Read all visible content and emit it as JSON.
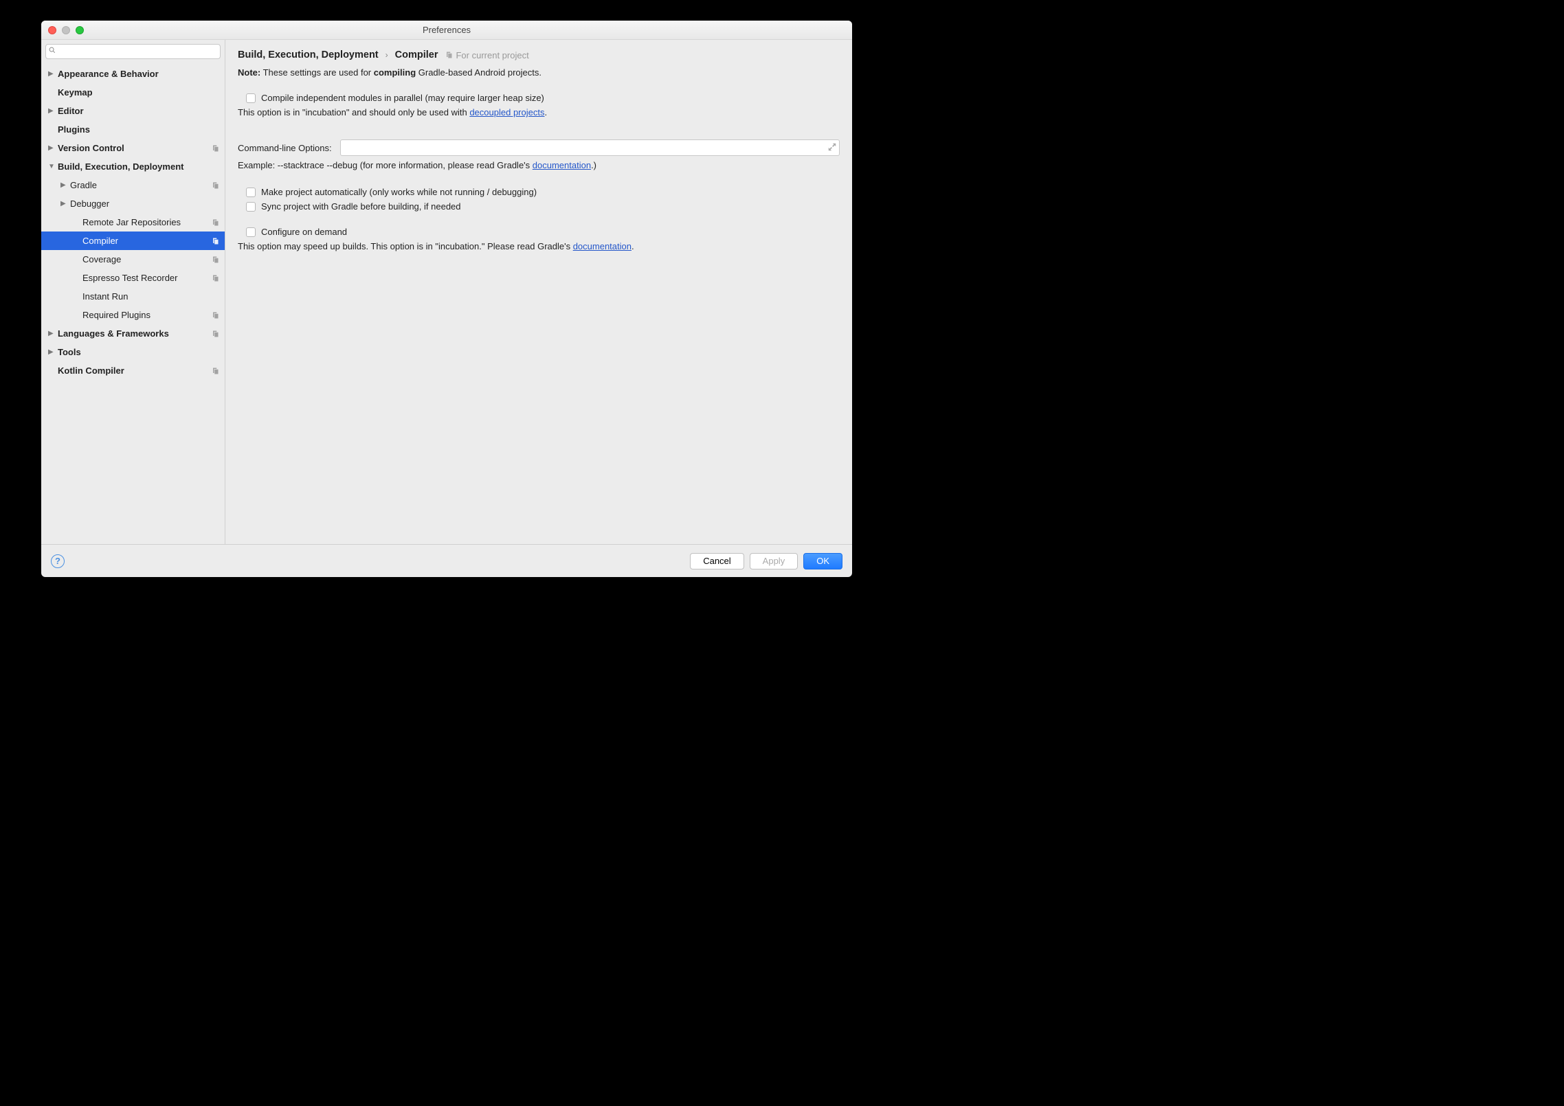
{
  "window": {
    "title": "Preferences"
  },
  "sidebar": {
    "search_placeholder": "",
    "items": [
      {
        "label": "Appearance & Behavior",
        "bold": true,
        "arrow": "right",
        "indent": 0
      },
      {
        "label": "Keymap",
        "bold": true,
        "indent": 0
      },
      {
        "label": "Editor",
        "bold": true,
        "arrow": "right",
        "indent": 0
      },
      {
        "label": "Plugins",
        "bold": true,
        "indent": 0
      },
      {
        "label": "Version Control",
        "bold": true,
        "arrow": "right",
        "indent": 0,
        "proj": true
      },
      {
        "label": "Build, Execution, Deployment",
        "bold": true,
        "arrow": "down",
        "indent": 0
      },
      {
        "label": "Gradle",
        "arrow": "right",
        "indent": 1,
        "proj": true
      },
      {
        "label": "Debugger",
        "arrow": "right",
        "indent": 1
      },
      {
        "label": "Remote Jar Repositories",
        "indent": 2,
        "proj": true
      },
      {
        "label": "Compiler",
        "indent": 2,
        "proj": true,
        "selected": true
      },
      {
        "label": "Coverage",
        "indent": 2,
        "proj": true
      },
      {
        "label": "Espresso Test Recorder",
        "indent": 2,
        "proj": true
      },
      {
        "label": "Instant Run",
        "indent": 2
      },
      {
        "label": "Required Plugins",
        "indent": 2,
        "proj": true
      },
      {
        "label": "Languages & Frameworks",
        "bold": true,
        "arrow": "right",
        "indent": 0,
        "proj": true
      },
      {
        "label": "Tools",
        "bold": true,
        "arrow": "right",
        "indent": 0
      },
      {
        "label": "Kotlin Compiler",
        "bold": true,
        "indent": 0,
        "proj": true
      }
    ]
  },
  "breadcrumb": {
    "parent": "Build, Execution, Deployment",
    "current": "Compiler",
    "scope": "For current project"
  },
  "content": {
    "note_prefix": "Note:",
    "note_mid1": " These settings are used for ",
    "note_bold": "compiling",
    "note_mid2": " Gradle-based Android projects.",
    "check1": "Compile independent modules in parallel (may require larger heap size)",
    "desc1_pre": "This option is in \"incubation\" and should only be used with ",
    "desc1_link": "decoupled projects",
    "desc1_post": ".",
    "cmd_label": "Command-line Options:",
    "cmd_value": "",
    "example_pre": "Example: --stacktrace --debug (for more information, please read Gradle's ",
    "example_link": "documentation",
    "example_post": ".)",
    "check2": "Make project automatically (only works while not running / debugging)",
    "check3": "Sync project with Gradle before building, if needed",
    "check4": "Configure on demand",
    "desc4_pre": "This option may speed up builds. This option is in \"incubation.\" Please read Gradle's ",
    "desc4_link": "documentation",
    "desc4_post": "."
  },
  "footer": {
    "cancel": "Cancel",
    "apply": "Apply",
    "ok": "OK"
  }
}
